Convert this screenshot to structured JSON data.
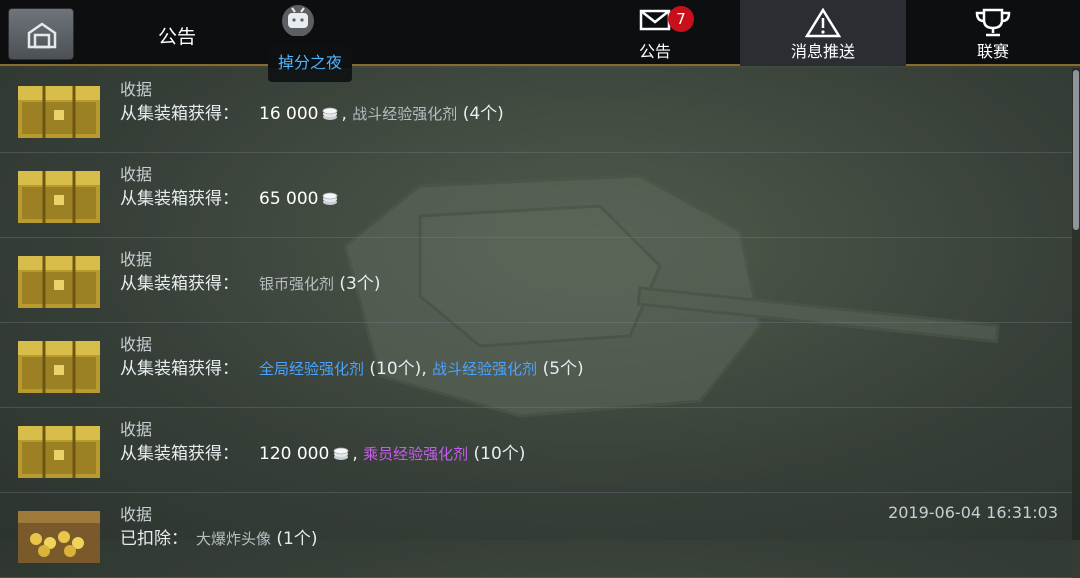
{
  "header": {
    "title": "公告",
    "overlay_app": "bilibili-tv-icon",
    "tooltip": "掉分之夜",
    "tabs": [
      {
        "label": "公告",
        "icon": "mail-icon",
        "badge": "7",
        "active": false
      },
      {
        "label": "消息推送",
        "icon": "warning-icon",
        "active": true
      },
      {
        "label": "联赛",
        "icon": "trophy-icon",
        "active": false
      }
    ]
  },
  "rewards": [
    {
      "title": "收据",
      "prefix": "从集装箱获得：",
      "amount": "16 000",
      "sep": ",",
      "items": [
        {
          "name": "战斗经验强化剂",
          "qty": "(4个)",
          "color": "grey"
        }
      ]
    },
    {
      "title": "收据",
      "prefix": "从集装箱获得：",
      "amount": "65 000",
      "items": []
    },
    {
      "title": "收据",
      "prefix": "从集装箱获得：",
      "items": [
        {
          "name": "银币强化剂",
          "qty": "(3个)",
          "color": "grey"
        }
      ]
    },
    {
      "title": "收据",
      "prefix": "从集装箱获得：",
      "items": [
        {
          "name": "全局经验强化剂",
          "qty": "(10个),",
          "color": "blue"
        },
        {
          "name": "战斗经验强化剂",
          "qty": "(5个)",
          "color": "blue"
        }
      ]
    },
    {
      "title": "收据",
      "prefix": "从集装箱获得：",
      "amount": "120 000",
      "sep": ",",
      "items": [
        {
          "name": "乘员经验强化剂",
          "qty": "(10个)",
          "color": "purple"
        }
      ]
    },
    {
      "title": "收据",
      "prefix": "已扣除：",
      "items": [
        {
          "name": "大爆炸头像",
          "qty": "(1个)",
          "color": "grey"
        }
      ],
      "date": "2019-06-04 16:31:03"
    }
  ],
  "colors": {
    "accent_gold": "#8a6a2a",
    "badge_red": "#c8101c",
    "blue_item": "#4aa3ff",
    "purple_item": "#c85cf0"
  }
}
